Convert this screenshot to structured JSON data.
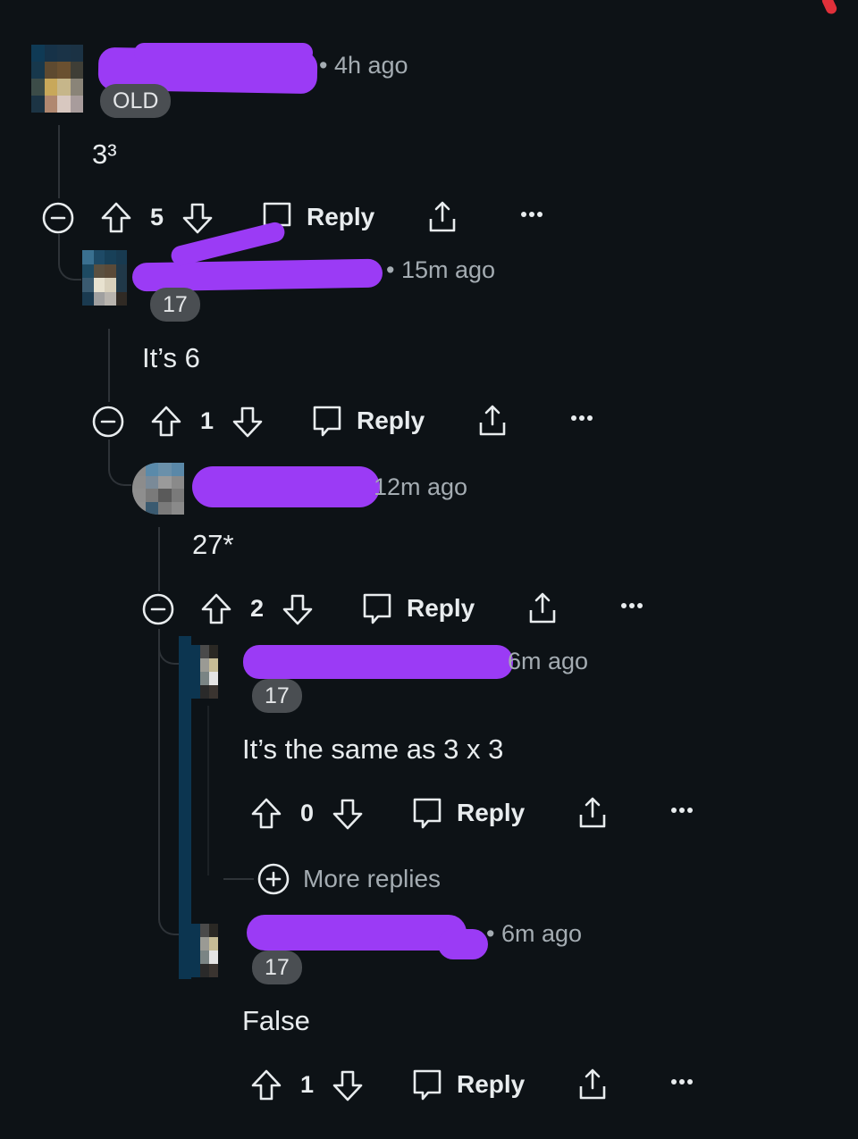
{
  "comments": [
    {
      "id": "c1",
      "username_redacted": true,
      "time": "• 4h ago",
      "flair": "OLD",
      "body": "3³",
      "score": "5",
      "reply_label": "Reply",
      "collapsed": false
    },
    {
      "id": "c2",
      "username_redacted": true,
      "time": "• 15m ago",
      "flair": "17",
      "body": "It’s 6",
      "score": "1",
      "reply_label": "Reply",
      "collapsed": false
    },
    {
      "id": "c3",
      "username_redacted": true,
      "time": "12m ago",
      "flair": "",
      "body": "27*",
      "score": "2",
      "reply_label": "Reply",
      "collapsed": false
    },
    {
      "id": "c4",
      "username_redacted": true,
      "time": "6m ago",
      "flair": "17",
      "body": "It’s the same as 3 x 3",
      "score": "0",
      "reply_label": "Reply"
    },
    {
      "id": "c5",
      "username_redacted": true,
      "time": "• 6m ago",
      "flair": "17",
      "body": "False",
      "score": "1",
      "reply_label": "Reply"
    }
  ],
  "more_replies": {
    "label": "More replies"
  },
  "icons": {
    "collapse": "minus-circle-icon",
    "upvote": "arrow-up-outline-icon",
    "downvote": "arrow-down-outline-icon",
    "reply": "speech-bubble-icon",
    "share": "share-upload-icon",
    "more": "ellipsis-icon",
    "expand": "plus-circle-icon"
  },
  "colors": {
    "background": "#0d1216",
    "redaction": "#9b3bf5",
    "thread_line": "#2e3338",
    "flair_bg": "#4a4e52",
    "muted_text": "#a4acb2"
  }
}
